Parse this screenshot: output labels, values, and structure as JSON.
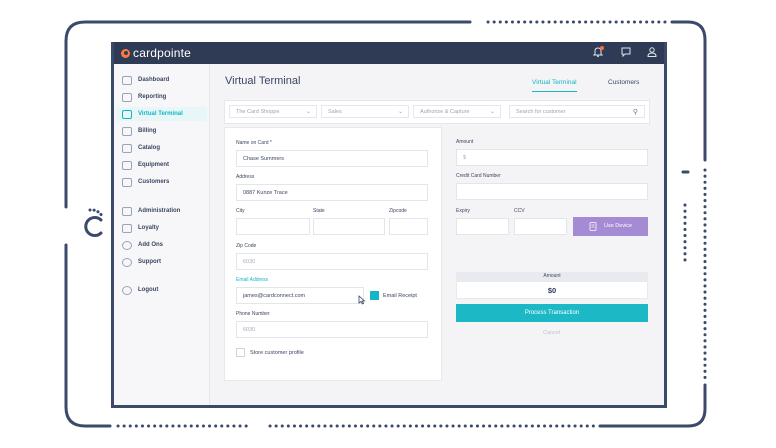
{
  "app": {
    "brand": "cardpointe",
    "topbar_icons": [
      "bell-icon",
      "chat-icon",
      "user-icon"
    ]
  },
  "sidebar": {
    "items": [
      {
        "label": "Dashboard",
        "icon": "dashboard-icon"
      },
      {
        "label": "Reporting",
        "icon": "chart-line-icon"
      },
      {
        "label": "Virtual Terminal",
        "icon": "terminal-icon",
        "active": true
      },
      {
        "label": "Billing",
        "icon": "billing-icon"
      },
      {
        "label": "Catalog",
        "icon": "box-icon"
      },
      {
        "label": "Equipment",
        "icon": "equipment-icon"
      },
      {
        "label": "Customers",
        "icon": "customers-icon"
      },
      {
        "label": "Administration",
        "icon": "admin-icon"
      },
      {
        "label": "Loyalty",
        "icon": "heart-icon"
      },
      {
        "label": "Add Ons",
        "icon": "plus-circle-icon"
      },
      {
        "label": "Support",
        "icon": "support-icon"
      },
      {
        "label": "Logout",
        "icon": "power-icon"
      }
    ]
  },
  "main": {
    "title": "Virtual Terminal",
    "tabs": [
      {
        "label": "Virtual Terminal",
        "active": true
      },
      {
        "label": "Customers",
        "active": false
      }
    ],
    "filters": {
      "merchant": "The Card Shoppe",
      "type": "Sales",
      "mode": "Authorize & Capture",
      "search_placeholder": "Search for customer"
    }
  },
  "customer_form": {
    "name_label": "Name on Card *",
    "name_value": "Chase Summers",
    "address_label": "Address",
    "address_value": "0887 Kunze Trace",
    "city_label": "City",
    "state_label": "State",
    "zipcode_label": "Zipcode",
    "zip_label": "Zip Code",
    "zip_placeholder": "6030",
    "email_label": "Email Address",
    "email_value": "james@cardconnect.com",
    "email_receipt_label": "Email Receipt",
    "email_receipt_checked": true,
    "phone_label": "Phone Number",
    "phone_placeholder": "6030",
    "store_label": "Store customer profile",
    "store_checked": false
  },
  "payment": {
    "amount_label": "Amount",
    "amount_placeholder": "$",
    "cc_label": "Credit Card Number",
    "expiry_label": "Expiry",
    "ccv_label": "CCV",
    "use_device_label": "Use Device",
    "summary_amount_label": "Amount",
    "summary_amount_value": "$0",
    "process_label": "Process Transaction",
    "cancel_label": "Cancel"
  },
  "colors": {
    "accent": "#13b5c6",
    "topbar": "#2f3b55",
    "device_button": "#a58bd3",
    "frame": "#3b4a6b"
  }
}
